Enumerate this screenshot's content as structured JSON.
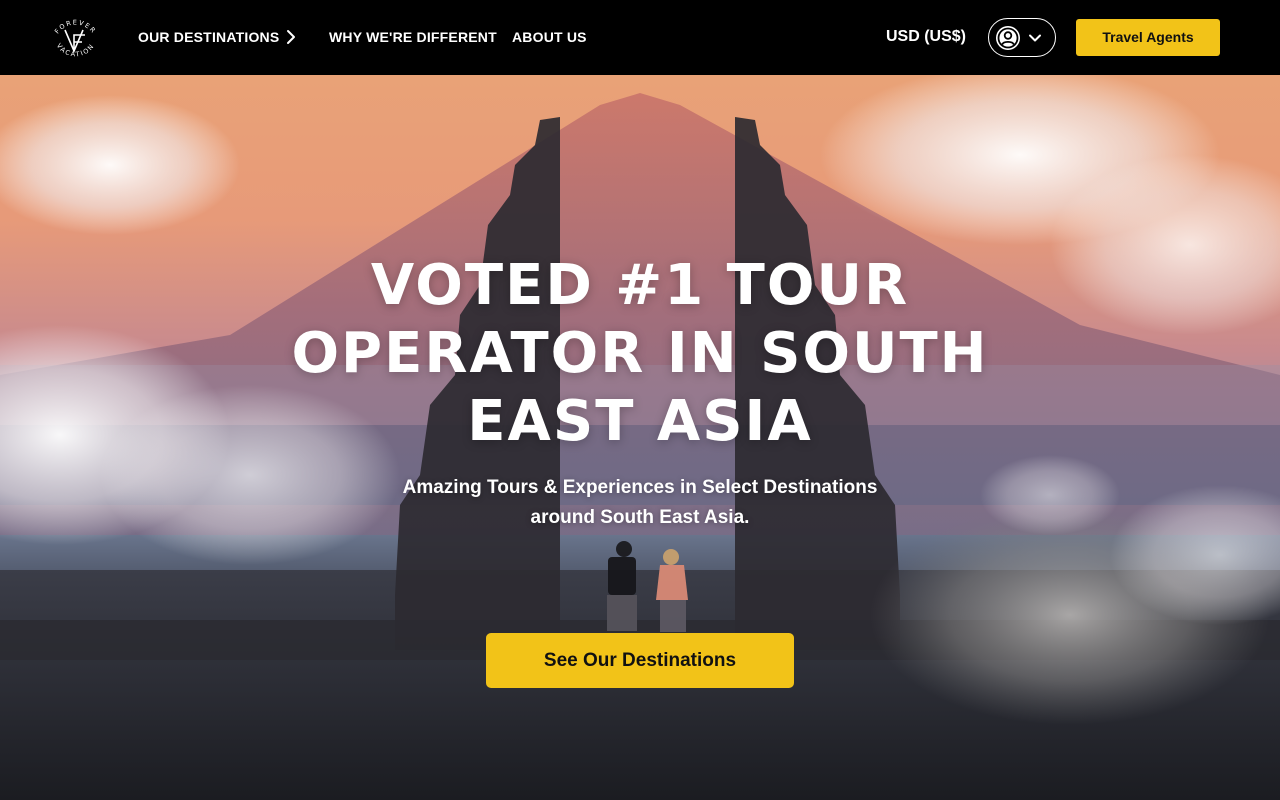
{
  "brand": {
    "logo_top_text": "FOREVER",
    "logo_bottom_text": "VACATION"
  },
  "nav": {
    "destinations_label": "OUR DESTINATIONS",
    "different_label": "WHY WE'RE DIFFERENT",
    "about_label": "ABOUT US"
  },
  "header": {
    "currency_label": "USD (US$)",
    "agents_label": "Travel Agents"
  },
  "hero": {
    "title": "VOTED #1 TOUR OPERATOR IN SOUTH EAST ASIA",
    "subtitle": "Amazing Tours & Experiences in Select Destinations around South East Asia.",
    "cta_label": "See Our Destinations"
  },
  "colors": {
    "accent": "#f2c318",
    "header_bg": "#000000",
    "text_light": "#ffffff"
  },
  "icons": [
    "chevron-right-icon",
    "user-icon",
    "chevron-down-icon"
  ]
}
